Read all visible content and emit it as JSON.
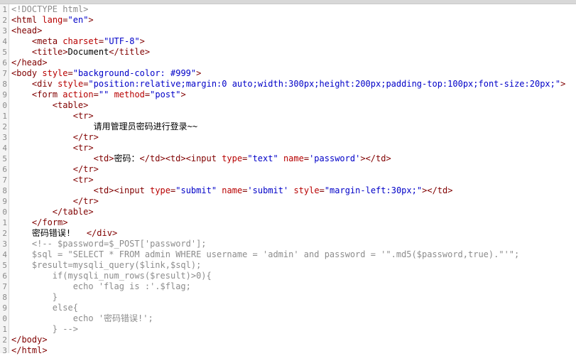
{
  "lines": [
    {
      "n": "1",
      "text": "<!DOCTYPE html>",
      "kind": "comment"
    },
    {
      "n": "2",
      "text": "<html lang=\"en\">",
      "kind": "tag"
    },
    {
      "n": "3",
      "text": "<head>",
      "kind": "tag"
    },
    {
      "n": "4",
      "text": "    <meta charset=\"UTF-8\">",
      "kind": "tag"
    },
    {
      "n": "5",
      "text": "    <title>Document</title>",
      "kind": "tag"
    },
    {
      "n": "6",
      "text": "</head>",
      "kind": "tag"
    },
    {
      "n": "7",
      "text": "<body style=\"background-color: #999\">",
      "kind": "tag"
    },
    {
      "n": "8",
      "text": "    <div style=\"position:relative;margin:0 auto;width:300px;height:200px;padding-top:100px;font-size:20px;\">",
      "kind": "tag"
    },
    {
      "n": "9",
      "text": "    <form action=\"\" method=\"post\">",
      "kind": "tag"
    },
    {
      "n": "0",
      "text": "        <table>",
      "kind": "tag"
    },
    {
      "n": "1",
      "text": "            <tr>",
      "kind": "tag"
    },
    {
      "n": "2",
      "text": "                请用管理员密码进行登录~~",
      "kind": "text"
    },
    {
      "n": "3",
      "text": "            </tr>",
      "kind": "tag"
    },
    {
      "n": "4",
      "text": "            <tr>",
      "kind": "tag"
    },
    {
      "n": "5",
      "text": "                <td>密码：</td><td><input type=\"text\" name='password'></td>",
      "kind": "tag"
    },
    {
      "n": "6",
      "text": "            </tr>",
      "kind": "tag"
    },
    {
      "n": "7",
      "text": "            <tr>",
      "kind": "tag"
    },
    {
      "n": "8",
      "text": "                <td><input type=\"submit\" name='submit' style=\"margin-left:30px;\"></td>",
      "kind": "tag"
    },
    {
      "n": "9",
      "text": "            </tr>",
      "kind": "tag"
    },
    {
      "n": "0",
      "text": "        </table>",
      "kind": "tag"
    },
    {
      "n": "1",
      "text": "    </form>",
      "kind": "tag"
    },
    {
      "n": "2",
      "text": "    密码错误!   </div>",
      "kind": "text"
    },
    {
      "n": "3",
      "text": "    <!-- $password=$_POST['password'];",
      "kind": "comment"
    },
    {
      "n": "4",
      "text": "    $sql = \"SELECT * FROM admin WHERE username = 'admin' and password = '\".md5($password,true).\"'\";",
      "kind": "comment"
    },
    {
      "n": "5",
      "text": "    $result=mysqli_query($link,$sql);",
      "kind": "comment"
    },
    {
      "n": "6",
      "text": "        if(mysqli_num_rows($result)>0){",
      "kind": "comment"
    },
    {
      "n": "7",
      "text": "            echo 'flag is :'.$flag;",
      "kind": "comment"
    },
    {
      "n": "8",
      "text": "        }",
      "kind": "comment"
    },
    {
      "n": "9",
      "text": "        else{",
      "kind": "comment"
    },
    {
      "n": "0",
      "text": "            echo '密码错误!';",
      "kind": "comment"
    },
    {
      "n": "1",
      "text": "        } -->",
      "kind": "comment"
    },
    {
      "n": "2",
      "text": "</body>",
      "kind": "tag"
    },
    {
      "n": "3",
      "text": "</html>",
      "kind": "tag"
    }
  ],
  "colors": {
    "tag": "#800000",
    "attr": "#b80000",
    "value": "#0000c8",
    "comment": "#8c8c8c",
    "text": "#000000"
  }
}
